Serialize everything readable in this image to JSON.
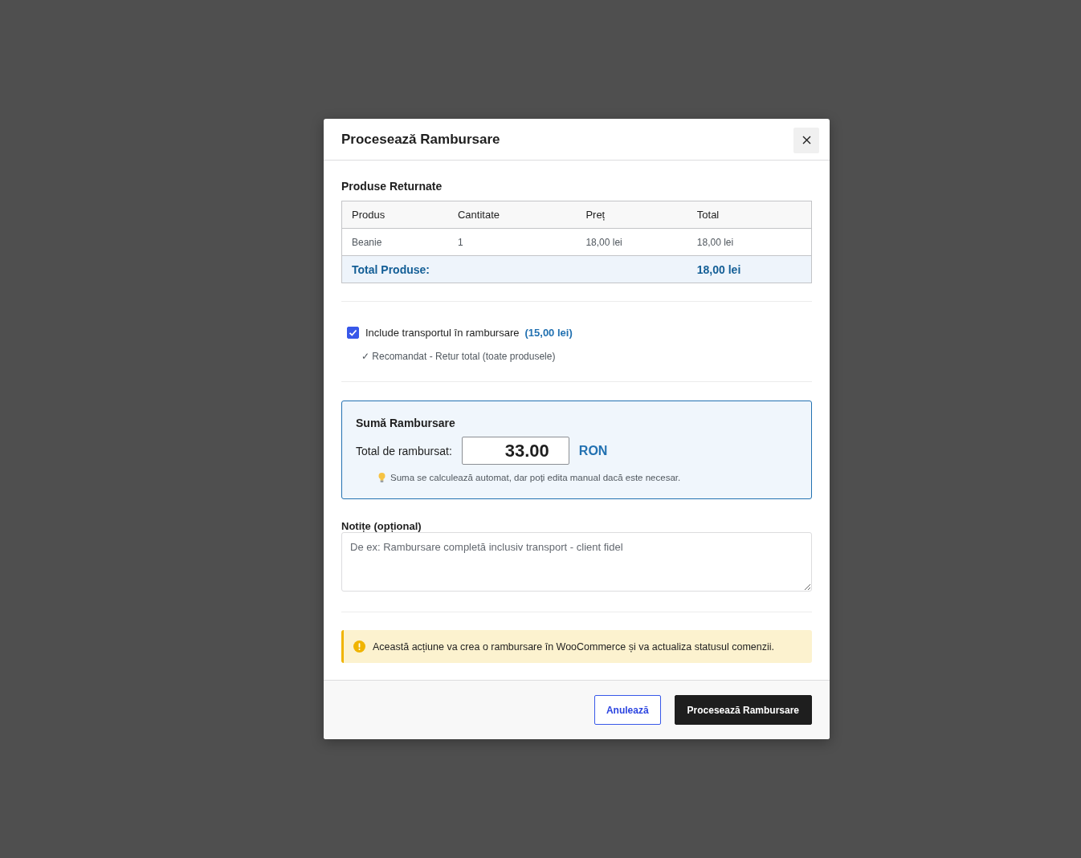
{
  "modal": {
    "title": "Procesează Rambursare"
  },
  "products": {
    "heading": "Produse Returnate",
    "columns": [
      "Produs",
      "Cantitate",
      "Preț",
      "Total"
    ],
    "rows": [
      [
        "Beanie",
        "1",
        "18,00 lei",
        "18,00 lei"
      ]
    ],
    "total": {
      "label": "Total Produse:",
      "value": "18,00 lei"
    }
  },
  "shipping": {
    "label": "Include transportul în rambursare",
    "amount": "(15,00 lei)",
    "checked": true,
    "note": "✓ Recomandat - Retur total (toate produsele)"
  },
  "refund": {
    "heading": "Sumă Rambursare",
    "label": "Total de rambursat:",
    "value": "33.00",
    "currency": "RON",
    "hint": "Suma se calculează automat, dar poți edita manual dacă este necesar."
  },
  "notes": {
    "label": "Notițe (opțional)",
    "placeholder": "De ex: Rambursare completă inclusiv transport - client fidel"
  },
  "warning": {
    "text": "Această acțiune va crea o rambursare în WooCommerce și va actualiza statusul comenzii."
  },
  "buttons": [
    {
      "label": "Anulează",
      "kind": "secondary"
    },
    {
      "label": "Procesează Rambursare",
      "kind": "primary"
    }
  ]
}
